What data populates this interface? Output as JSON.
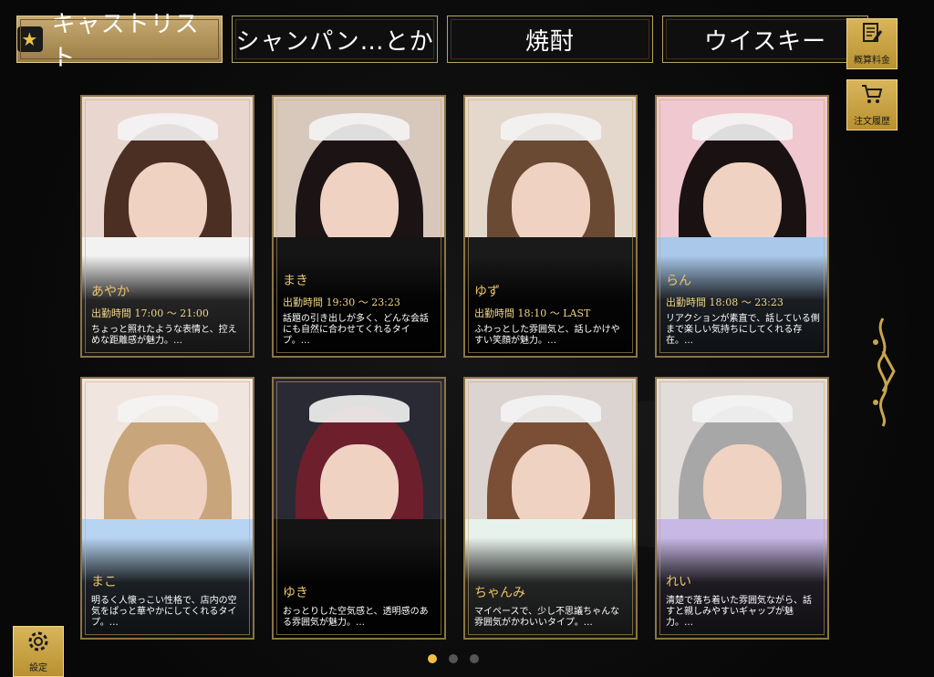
{
  "tabs": [
    {
      "label": "キャストリスト",
      "active": true,
      "icon": "star-icon"
    },
    {
      "label": "シャンパン…とか",
      "active": false
    },
    {
      "label": "焼酎",
      "active": false
    },
    {
      "label": "ウイスキー",
      "active": false
    }
  ],
  "side_buttons": {
    "estimate": {
      "label": "概算料金",
      "icon": "document-pen-icon"
    },
    "order_history": {
      "label": "注文履歴",
      "icon": "cart-icon"
    }
  },
  "settings": {
    "label": "設定",
    "icon": "gear-icon"
  },
  "pagination": {
    "pages": 3,
    "current": 1
  },
  "casts": [
    {
      "name": "あやか",
      "hours": "出勤時間  17:00 〜 21:00",
      "desc": "ちょっと照れたような表情と、控えめな距離感が魅力。…",
      "hair": "#4a2f22",
      "outfit": "#f2f2f2",
      "bg": "#e9d7cf"
    },
    {
      "name": "まき",
      "hours": "出勤時間  19:30 〜 23:23",
      "desc": "話題の引き出しが多く、どんな会話にも自然に合わせてくれるタイプ。…",
      "hair": "#1c1414",
      "outfit": "#151515",
      "bg": "#d8c8bc"
    },
    {
      "name": "ゆず",
      "hours": "出勤時間  18:10 〜 LAST",
      "desc": "ふわっとした雰囲気と、話しかけやすい笑顔が魅力。…",
      "hair": "#6b4a34",
      "outfit": "#1a1a1a",
      "bg": "#e4d8cc"
    },
    {
      "name": "らん",
      "hours": "出勤時間  18:08 〜 23:23",
      "desc": "リアクションが素直で、話している側まで楽しい気持ちにしてくれる存在。…",
      "hair": "#1a1212",
      "outfit": "#a9c8ea",
      "bg": "#f0c8cf"
    },
    {
      "name": "まこ",
      "hours": "",
      "desc": "明るく人懐っこい性格で、店内の空気をぱっと華やかにしてくれるタイプ。…",
      "hair": "#c8a57a",
      "outfit": "#b7d4f2",
      "bg": "#f1e5e0"
    },
    {
      "name": "ゆき",
      "hours": "",
      "desc": "おっとりした空気感と、透明感のある雰囲気が魅力。…",
      "hair": "#6e1f2c",
      "outfit": "#141414",
      "bg": "#2a2a34"
    },
    {
      "name": "ちゃんみ",
      "hours": "",
      "desc": "マイペースで、少し不思議ちゃんな雰囲気がかわいいタイプ。…",
      "hair": "#7a4f35",
      "outfit": "#e8f2ec",
      "bg": "#dcd4d0"
    },
    {
      "name": "れい",
      "hours": "",
      "desc": "清楚で落ち着いた雰囲気ながら、話すと親しみやすいギャップが魅力。…",
      "hair": "#a7a7a7",
      "outfit": "#c8b8e6",
      "bg": "#e2dcda"
    }
  ],
  "colors": {
    "accent": "#c8ab73",
    "gold": "#e9c36a",
    "dot_active": "#f0c040"
  }
}
